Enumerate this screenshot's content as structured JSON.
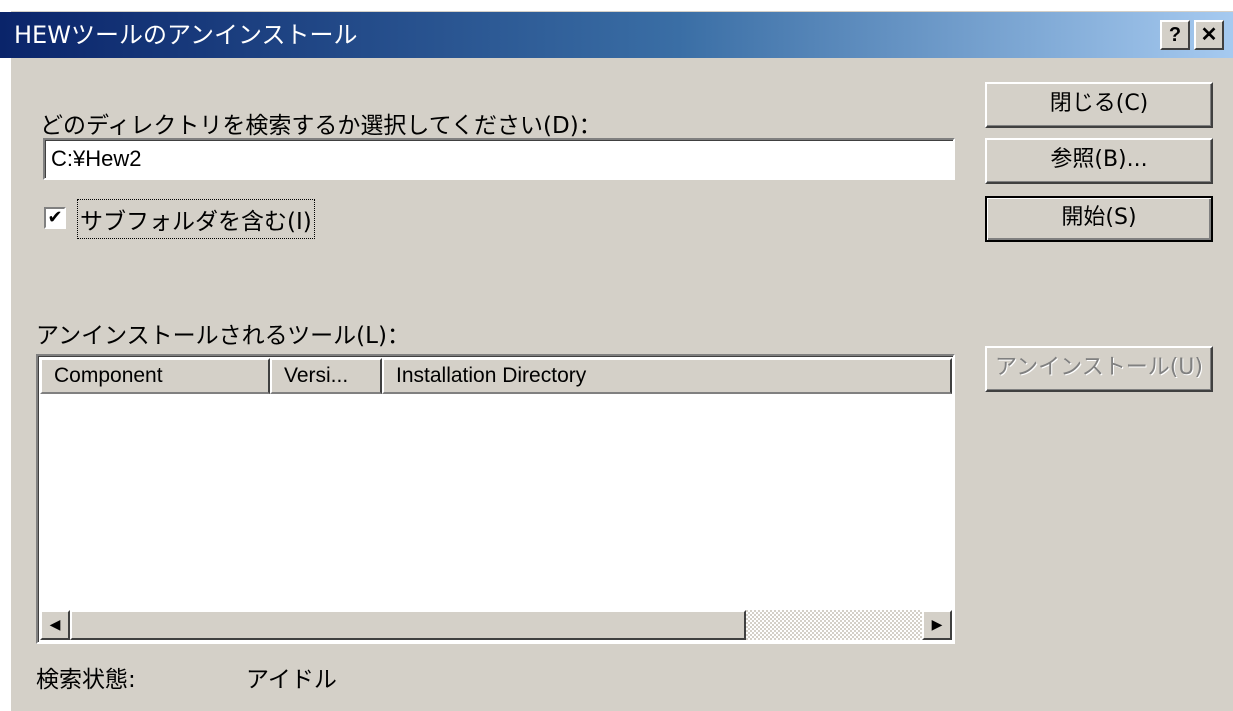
{
  "window": {
    "title": "HEWツールのアンインストール",
    "help_glyph": "?",
    "close_glyph": "✕"
  },
  "search_dir": {
    "label": "どのディレクトリを検索するか選択してください(D)：",
    "value": "C:¥Hew2"
  },
  "subfolders": {
    "label": "サブフォルダを含む(I)",
    "checked": true,
    "check_glyph": "✔"
  },
  "buttons": {
    "close": "閉じる(C)",
    "browse": "参照(B)...",
    "start": "開始(S)",
    "uninstall": "アンインストール(U)"
  },
  "tools_list": {
    "label": "アンインストールされるツール(L)：",
    "columns": [
      "Component",
      "Versi...",
      "Installation Directory"
    ],
    "rows": []
  },
  "scrollbar": {
    "left_glyph": "◀",
    "right_glyph": "▶"
  },
  "status": {
    "label": "検索状態:",
    "value": "アイドル"
  }
}
